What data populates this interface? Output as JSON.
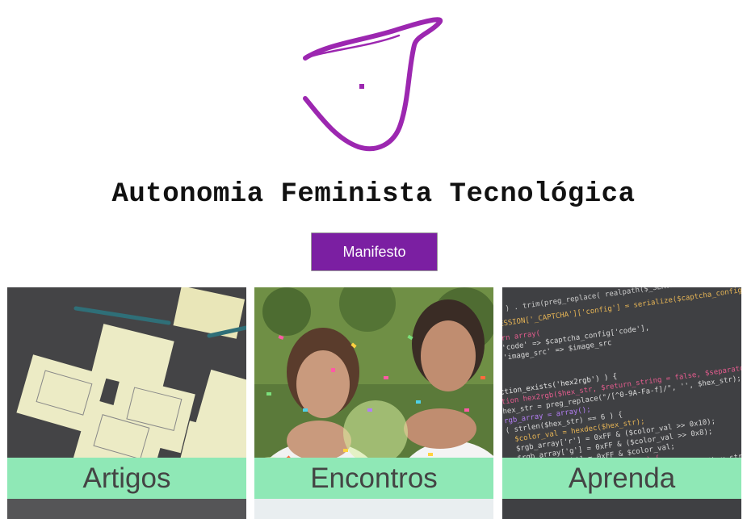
{
  "header": {
    "logo_icon": "ribbon-logo-icon",
    "title": "Autonomia Feminista Tecnológica",
    "manifesto_label": "Manifesto"
  },
  "colors": {
    "accent": "#7b1fa2",
    "logo": "#9c27b0",
    "card_label_bg": "#8fe8b6",
    "card_label_text": "#444444"
  },
  "cards": [
    {
      "label": "Artigos",
      "image": "sticky-notes-photo"
    },
    {
      "label": "Encontros",
      "image": "confetti-celebration-photo"
    },
    {
      "label": "Aprenda",
      "image": "code-screen-photo"
    }
  ]
}
